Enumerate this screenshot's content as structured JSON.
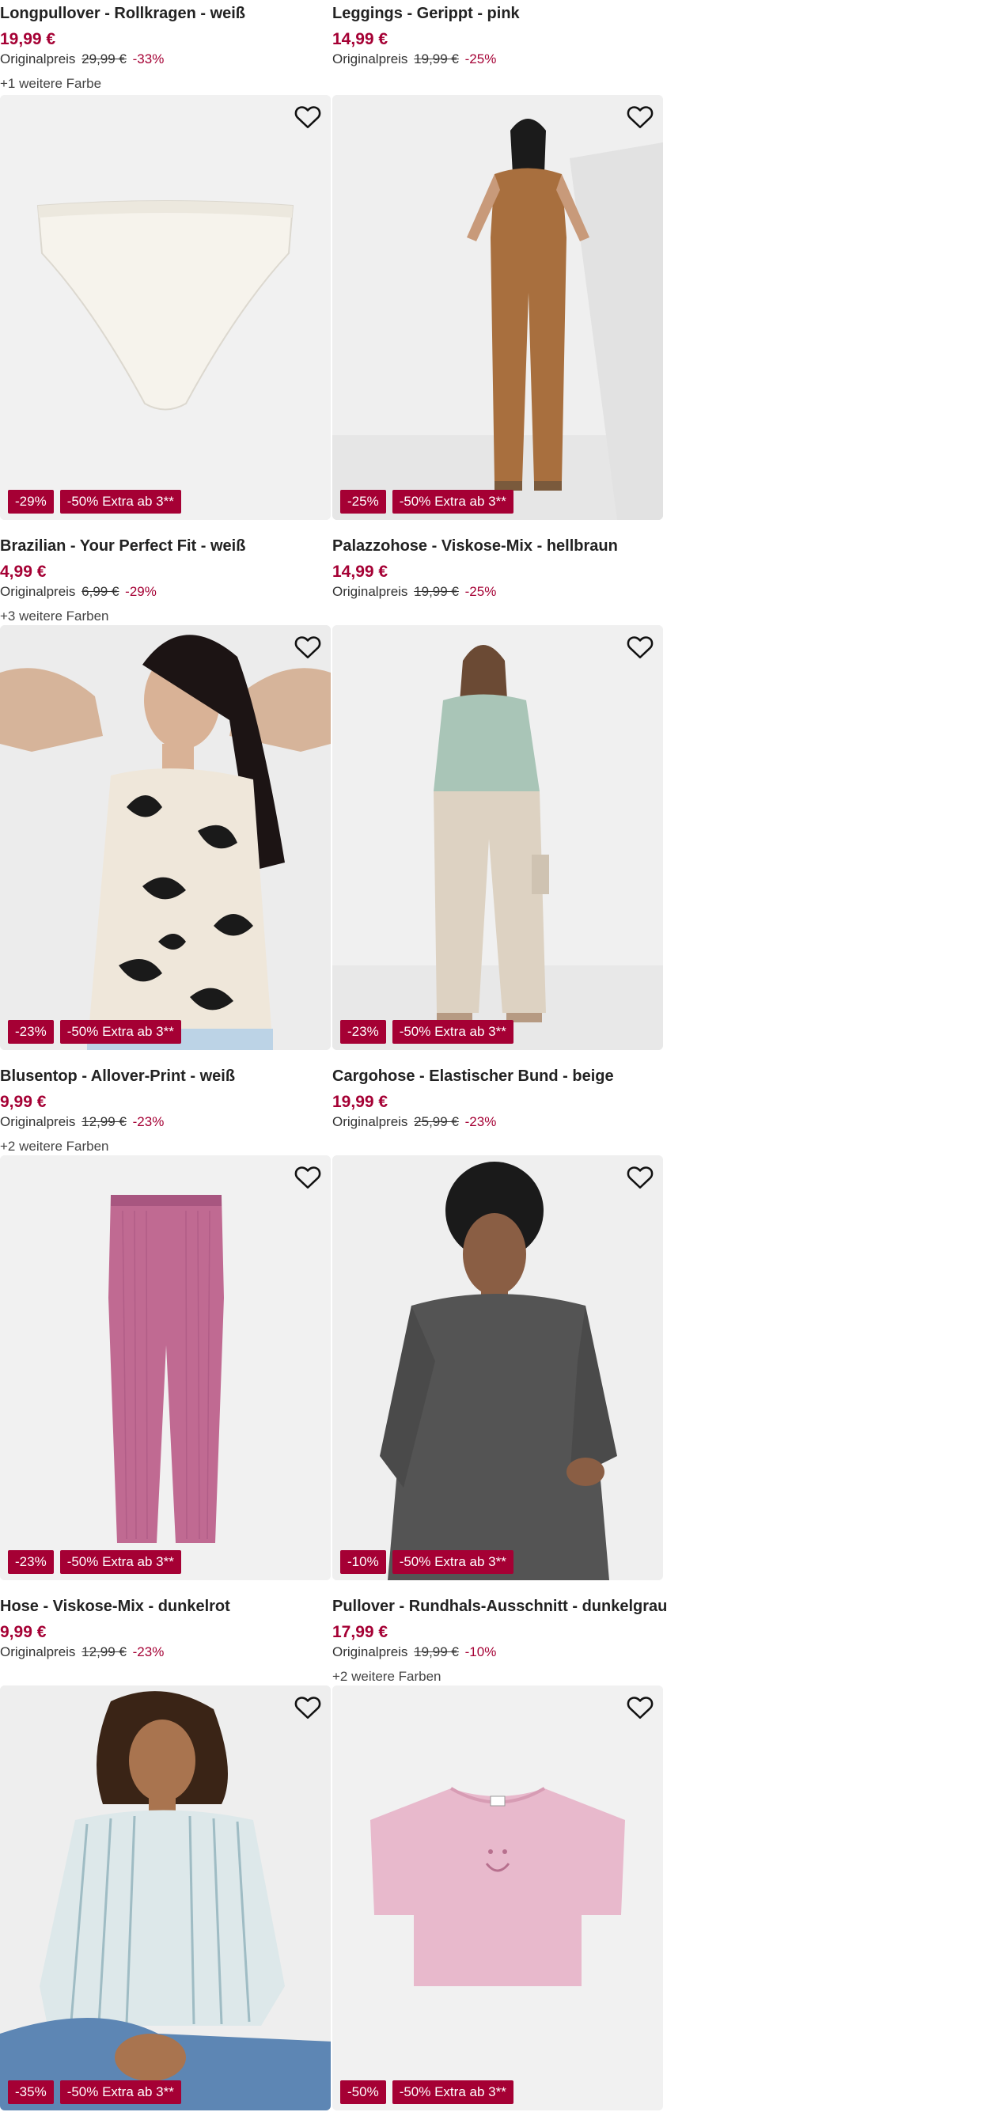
{
  "products": [
    {
      "title": "Longpullover - Rollkragen - weiß",
      "price": "19,99 €",
      "orig_label": "Originalpreis",
      "orig_price": "29,99 €",
      "discount": "-33%",
      "colors": "+1 weitere Farbe"
    },
    {
      "title": "Leggings - Gerippt - pink",
      "price": "14,99 €",
      "orig_label": "Originalpreis",
      "orig_price": "19,99 €",
      "discount": "-25%",
      "colors": ""
    },
    {
      "title": "Brazilian - Your Perfect Fit - weiß",
      "price": "4,99 €",
      "orig_label": "Originalpreis",
      "orig_price": "6,99 €",
      "discount": "-29%",
      "colors": "+3 weitere Farben",
      "badges": [
        "-29%",
        "-50% Extra ab 3**"
      ],
      "image": "white-brief"
    },
    {
      "title": "Palazzohose - Viskose-Mix - hellbraun",
      "price": "14,99 €",
      "orig_label": "Originalpreis",
      "orig_price": "19,99 €",
      "discount": "-25%",
      "colors": "",
      "badges": [
        "-25%",
        "-50% Extra ab 3**"
      ],
      "image": "model-brown-set"
    },
    {
      "title": "Blusentop - Allover-Print - weiß",
      "price": "9,99 €",
      "orig_label": "Originalpreis",
      "orig_price": "12,99 €",
      "discount": "-23%",
      "colors": "+2 weitere Farben",
      "badges": [
        "-23%",
        "-50% Extra ab 3**"
      ],
      "image": "model-floral-top"
    },
    {
      "title": "Cargohose - Elastischer Bund - beige",
      "price": "19,99 €",
      "orig_label": "Originalpreis",
      "orig_price": "25,99 €",
      "discount": "-23%",
      "colors": "",
      "badges": [
        "-23%",
        "-50% Extra ab 3**"
      ],
      "image": "model-beige-cargo"
    },
    {
      "title": "Hose - Viskose-Mix - dunkelrot",
      "price": "9,99 €",
      "orig_label": "Originalpreis",
      "orig_price": "12,99 €",
      "discount": "-23%",
      "colors": "",
      "badges": [
        "-23%",
        "-50% Extra ab 3**"
      ],
      "image": "pink-ribbed-pants"
    },
    {
      "title": "Pullover - Rundhals-Ausschnitt - dunkelgrau",
      "price": "17,99 €",
      "orig_label": "Originalpreis",
      "orig_price": "19,99 €",
      "discount": "-10%",
      "colors": "+2 weitere Farben",
      "badges": [
        "-10%",
        "-50% Extra ab 3**"
      ],
      "image": "model-grey-sweater"
    },
    {
      "badges": [
        "-35%",
        "-50% Extra ab 3**"
      ],
      "image": "model-striped-blouse"
    },
    {
      "badges": [
        "-50%",
        "-50% Extra ab 3**"
      ],
      "image": "pink-tshirt"
    }
  ],
  "colors": {
    "accent": "#a50034",
    "image_bg": "#f1f1f1"
  },
  "icons": {
    "wishlist": "heart-outline-icon"
  }
}
